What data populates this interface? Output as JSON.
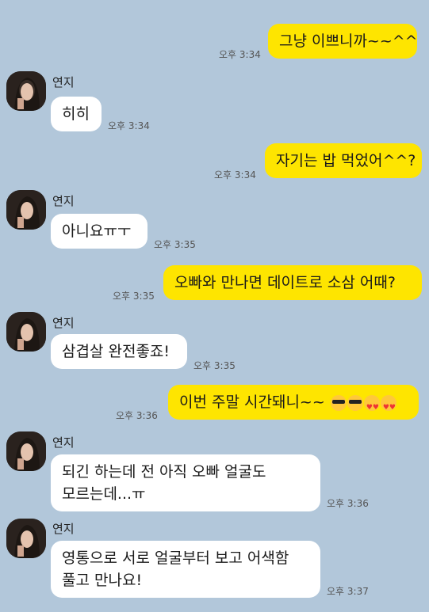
{
  "contact": {
    "name": "연지"
  },
  "messages": [
    {
      "from": "me",
      "text": "그냥 이쁘니까~~^^",
      "time": "오후 3:34"
    },
    {
      "from": "other",
      "text": "히히",
      "time": "오후 3:34"
    },
    {
      "from": "me",
      "text": "자기는 밥 먹었어^^?",
      "time": "오후 3:34"
    },
    {
      "from": "other",
      "text": "아니요ㅠㅜ",
      "time": "오후 3:35"
    },
    {
      "from": "me",
      "text": "오빠와 만나면 데이트로 소삼 어때?",
      "time": "오후 3:35"
    },
    {
      "from": "other",
      "text": "삼겹살 완전좋죠!",
      "time": "오후 3:35"
    },
    {
      "from": "me",
      "text": "이번 주말 시간돼니~~",
      "time": "오후 3:36",
      "emoji": [
        "sunglasses-emoji",
        "sunglasses-emoji",
        "heart-eyes-emoji",
        "heart-eyes-emoji"
      ]
    },
    {
      "from": "other",
      "lines": [
        "되긴 하는데 전 아직 오빠 얼굴도",
        "모르는데...ㅠ"
      ],
      "time": "오후 3:36"
    },
    {
      "from": "other",
      "lines": [
        "영통으로 서로 얼굴부터 보고 어색함",
        "풀고 만나요!"
      ],
      "time": "오후 3:37"
    }
  ],
  "colors": {
    "background": "#b2c7da",
    "my_bubble": "#fee500",
    "their_bubble": "#ffffff"
  }
}
